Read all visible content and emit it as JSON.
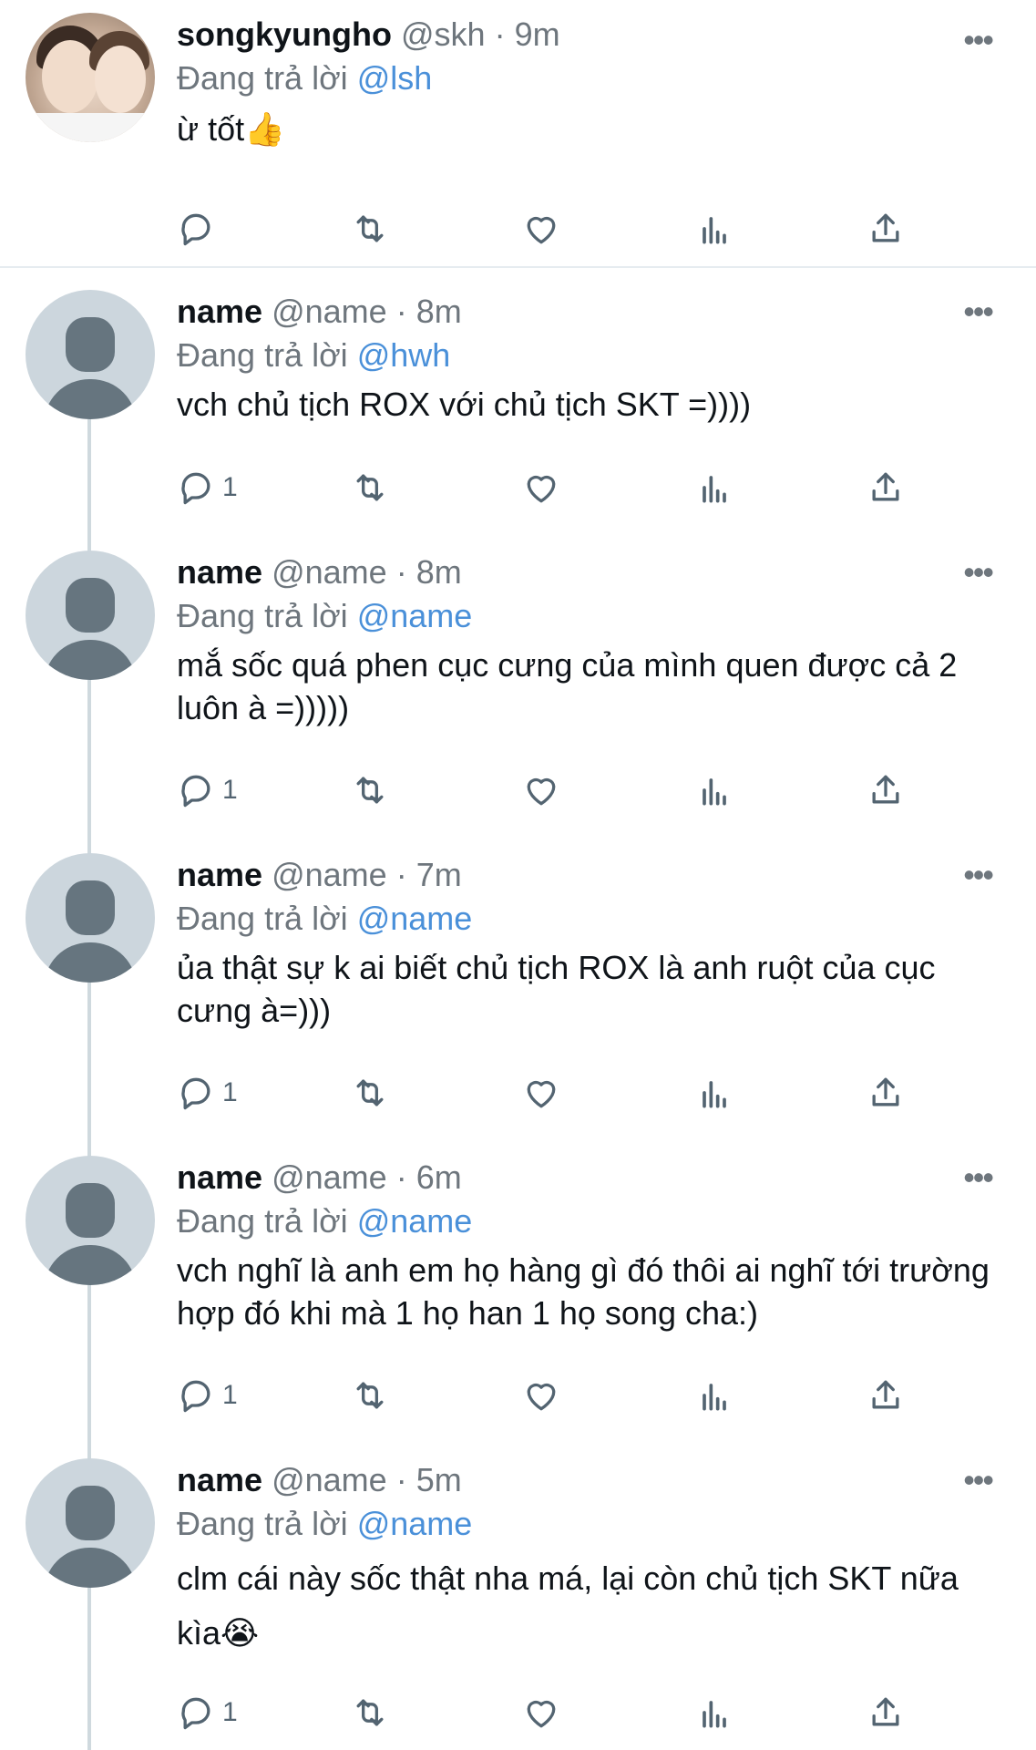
{
  "colors": {
    "mention": "#4a90d9",
    "muted": "#6e767d",
    "text": "#0f1419",
    "avatar_bg": "#ccd6dd"
  },
  "tweets": [
    {
      "name": "songkyungho",
      "handle": "@skh",
      "time": "9m",
      "reply_prefix": "Đang trả lời",
      "reply_to": "@lsh",
      "text": "ừ tốt👍",
      "reply_count": "",
      "avatar": "photo"
    },
    {
      "name": "name",
      "handle": "@name",
      "time": "8m",
      "reply_prefix": "Đang trả lời",
      "reply_to": "@hwh",
      "text": "vch chủ tịch ROX với chủ tịch SKT =))))",
      "reply_count": "1",
      "avatar": "default"
    },
    {
      "name": "name",
      "handle": "@name",
      "time": "8m",
      "reply_prefix": "Đang trả lời",
      "reply_to": "@name",
      "text": "mắ sốc quá phen cục cưng của mình quen được cả 2 luôn à =)))))",
      "reply_count": "1",
      "avatar": "default"
    },
    {
      "name": "name",
      "handle": "@name",
      "time": "7m",
      "reply_prefix": "Đang trả lời",
      "reply_to": "@name",
      "text": "ủa thật sự k ai biết chủ tịch ROX là anh ruột của cục cưng à=)))",
      "reply_count": "1",
      "avatar": "default"
    },
    {
      "name": "name",
      "handle": "@name",
      "time": "6m",
      "reply_prefix": "Đang trả lời",
      "reply_to": "@name",
      "text": "vch nghĩ là anh em họ hàng gì đó thôi ai nghĩ tới trường hợp đó khi mà 1 họ han 1 họ song cha:)",
      "reply_count": "1",
      "avatar": "default"
    },
    {
      "name": "name",
      "handle": "@name",
      "time": "5m",
      "reply_prefix": "Đang trả lời",
      "reply_to": "@name",
      "text": "clm cái này sốc thật nha má, lại còn chủ tịch SKT nữa kìa😭",
      "reply_count": "1",
      "avatar": "default"
    }
  ],
  "icons": {
    "more": "more-dots-icon",
    "reply": "reply-icon",
    "retweet": "retweet-icon",
    "like": "heart-icon",
    "stats": "stats-icon",
    "share": "share-icon"
  },
  "labels": {
    "separator": "·",
    "more": "•••"
  }
}
